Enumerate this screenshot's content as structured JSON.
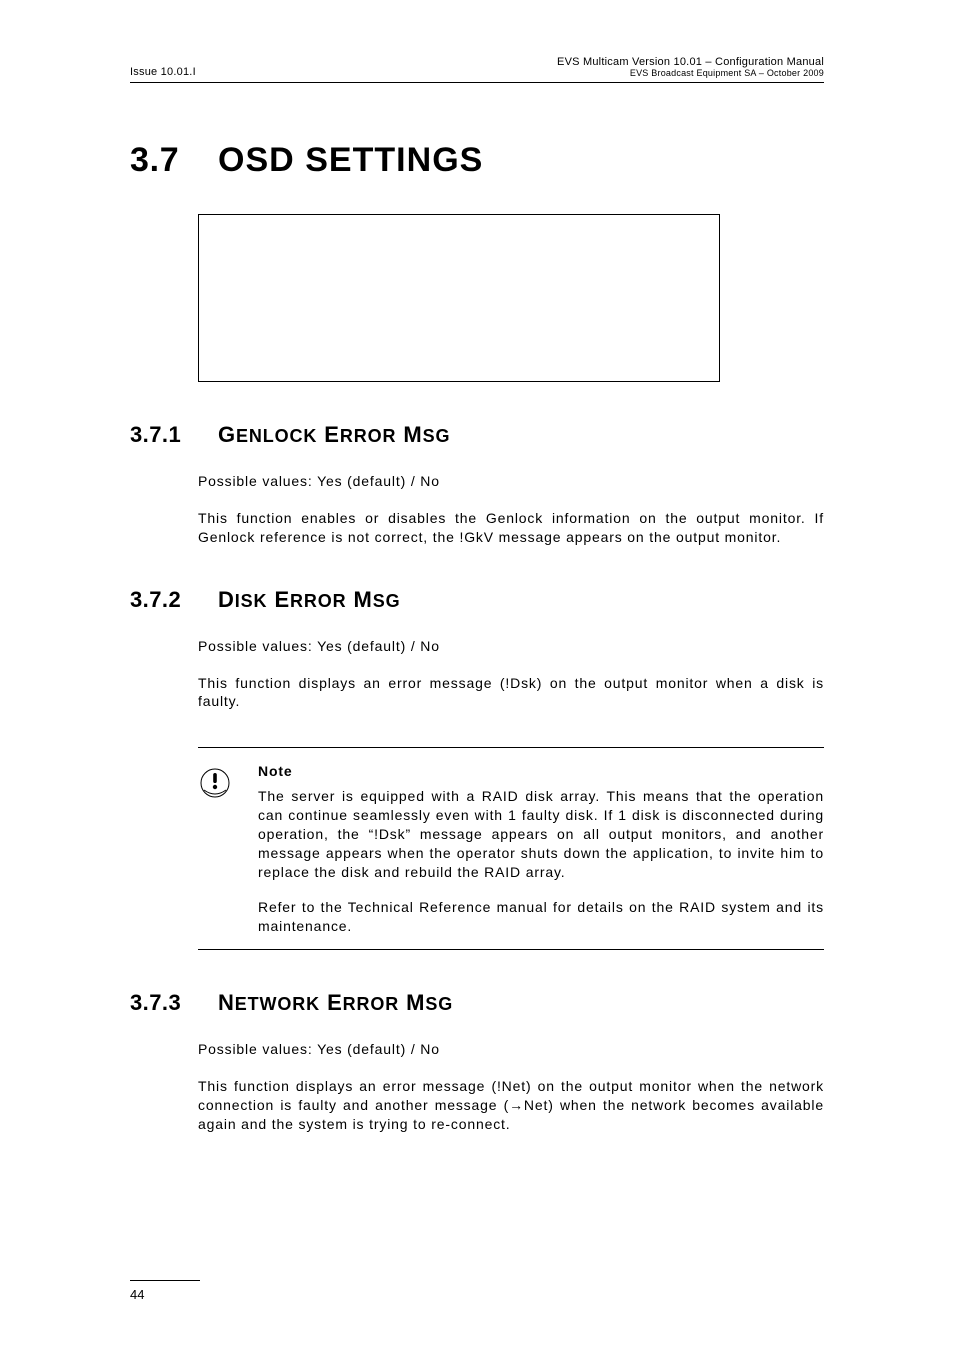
{
  "header": {
    "issue": "Issue 10.01.I",
    "doc_title": "EVS Multicam Version 10.01 – Configuration Manual",
    "doc_sub": "EVS Broadcast Equipment SA – October 2009"
  },
  "main": {
    "section_num": "3.7",
    "section_title": "OSD SETTINGS"
  },
  "s1": {
    "num": "3.7.1",
    "title_g": "G",
    "title_enlock": "ENLOCK",
    "title_e": "E",
    "title_rror": "RROR",
    "title_m": "M",
    "title_sg": "SG",
    "possible": "Possible values: Yes (default) / No",
    "body": "This function enables or disables the Genlock information on the output monitor. If Genlock reference is not correct, the !GkV message appears on the output monitor."
  },
  "s2": {
    "num": "3.7.2",
    "title_d": "D",
    "title_isk": "ISK",
    "title_e": "E",
    "title_rror": "RROR",
    "title_m": "M",
    "title_sg": "SG",
    "possible": "Possible values: Yes (default) / No",
    "body": "This function displays an error message (!Dsk) on the output monitor when a disk is faulty."
  },
  "note": {
    "label": "Note",
    "p1": "The server is equipped with a RAID disk array. This means that the operation can continue seamlessly even with 1 faulty disk. If 1 disk is disconnected during operation, the “!Dsk” message appears on all output monitors, and another message appears when the operator shuts down the application, to invite him to replace the disk and rebuild the RAID array.",
    "p2": "Refer to the Technical Reference manual for details on the RAID system and its maintenance."
  },
  "s3": {
    "num": "3.7.3",
    "title_n": "N",
    "title_etwork": "ETWORK",
    "title_e": "E",
    "title_rror": "RROR",
    "title_m": "M",
    "title_sg": "SG",
    "possible": "Possible values: Yes (default) / No",
    "body": "This function displays an error message (!Net) on the output monitor when the network connection is faulty and another message (→Net) when the network becomes available again and the system is trying to re-connect."
  },
  "footer": {
    "page": "44"
  }
}
